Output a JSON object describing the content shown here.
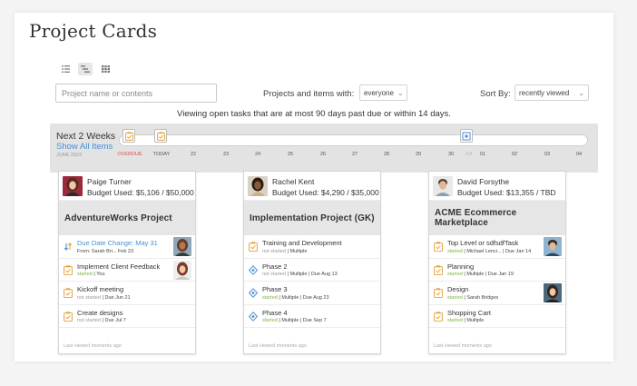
{
  "page": {
    "title": "Project Cards"
  },
  "view_icons": [
    "list-view-icon",
    "timeline-view-icon",
    "grid-view-icon"
  ],
  "search": {
    "placeholder": "Project name or contents",
    "value": ""
  },
  "filter": {
    "label": "Projects and items with:",
    "value": "everyone"
  },
  "sort": {
    "label": "Sort By:",
    "value": "recently viewed"
  },
  "viewing_text": "Viewing open tasks that are at most 90 days past due or within 14 days.",
  "timeline": {
    "title": "Next 2 Weeks",
    "show_all": "Show All Items",
    "year_label": "JUNE 2022",
    "ticks": [
      "OVERDUE",
      "TODAY",
      "22",
      "23",
      "24",
      "25",
      "26",
      "27",
      "28",
      "29",
      "30",
      "JUL",
      "01",
      "02",
      "03",
      "04"
    ]
  },
  "colors": {
    "accent": "#4a90d9",
    "overdue": "#d9534f",
    "started": "#7cb342",
    "task_icon": "#e8a33d",
    "phase_icon": "#4a90d9"
  },
  "cards": [
    {
      "owner": "Paige Turner",
      "budget": "Budget Used: $5,106 / $50,000",
      "project": "AdventureWorks Project",
      "tasks": [
        {
          "icon": "date-change-icon",
          "name": "Due Date Change: May 31",
          "sub_plain": "From: Sarah Bri... Feb 23"
        },
        {
          "icon": "task-icon",
          "name": "Implement Client Feedback",
          "status": "started",
          "meta": "| You"
        },
        {
          "icon": "task-icon",
          "name": "Kickoff meeting",
          "status": "not started",
          "meta": "| Due Jun 21"
        },
        {
          "icon": "task-icon",
          "name": "Create designs",
          "status": "not started",
          "meta": "| Due Jul 7"
        }
      ],
      "footer": "Last viewed moments ago"
    },
    {
      "owner": "Rachel Kent",
      "budget": "Budget Used: $4,290 / $35,000",
      "project": "Implementation Project (GK)",
      "tasks": [
        {
          "icon": "task-icon",
          "name": "Training and Development",
          "status": "not started",
          "meta": "| Multiple"
        },
        {
          "icon": "phase-icon",
          "name": "Phase 2",
          "status": "not started",
          "meta": "| Multiple | Due Aug 13"
        },
        {
          "icon": "phase-icon",
          "name": "Phase 3",
          "status": "started",
          "meta": "| Multiple | Due Aug 23"
        },
        {
          "icon": "phase-icon",
          "name": "Phase 4",
          "status": "started",
          "meta": "| Multiple | Due Sep 7"
        }
      ],
      "footer": "Last viewed moments ago"
    },
    {
      "owner": "David Forsythe",
      "budget": "Budget Used: $13,355 / TBD",
      "project": "ACME Ecommerce Marketplace",
      "tasks": [
        {
          "icon": "task-icon",
          "name": "Top Level or sdfsdfTask",
          "status": "started",
          "meta": "| Michael Lenci... | Due Jan 14"
        },
        {
          "icon": "task-icon",
          "name": "Planning",
          "status": "started",
          "meta": "| Multiple | Due Jan 19"
        },
        {
          "icon": "task-icon",
          "name": "Design",
          "status": "started",
          "meta": "| Sarah Bridges"
        },
        {
          "icon": "task-icon",
          "name": "Shopping Cart",
          "status": "started",
          "meta": "| Multiple"
        }
      ],
      "footer": "Last viewed moments ago"
    }
  ]
}
